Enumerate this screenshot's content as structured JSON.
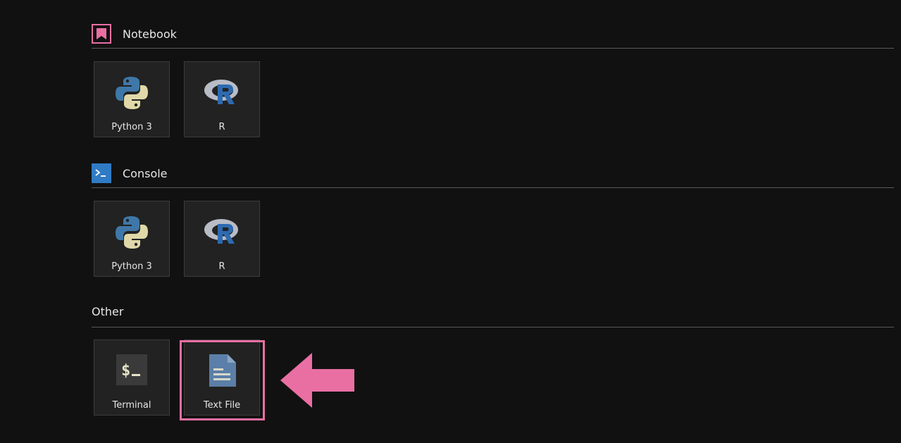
{
  "sections": {
    "notebook": {
      "title": "Notebook",
      "icon": "notebook-bookmark-icon",
      "icon_color": "#e96fa3",
      "kernels": [
        {
          "label": "Python 3",
          "icon": "python-logo-icon"
        },
        {
          "label": "R",
          "icon": "r-logo-icon"
        }
      ]
    },
    "console": {
      "title": "Console",
      "icon": "console-prompt-icon",
      "icon_color": "#2f7bc4",
      "kernels": [
        {
          "label": "Python 3",
          "icon": "python-logo-icon"
        },
        {
          "label": "R",
          "icon": "r-logo-icon"
        }
      ]
    },
    "other": {
      "title": "Other",
      "items": [
        {
          "label": "Terminal",
          "icon": "terminal-icon"
        },
        {
          "label": "Text File",
          "icon": "text-file-icon"
        }
      ]
    }
  },
  "annotation": {
    "highlight_color": "#e96fa3",
    "arrow_color": "#e96fa3",
    "arrow_direction": "left",
    "highlighted_item": "Text File"
  },
  "colors": {
    "background": "#111111",
    "card_background": "#222222",
    "divider": "#5a5a5a",
    "python_blue": "#3f78a8",
    "python_yellow": "#e0d8a8",
    "r_blue": "#2d6ab0",
    "r_grey": "#b8bcc6"
  }
}
